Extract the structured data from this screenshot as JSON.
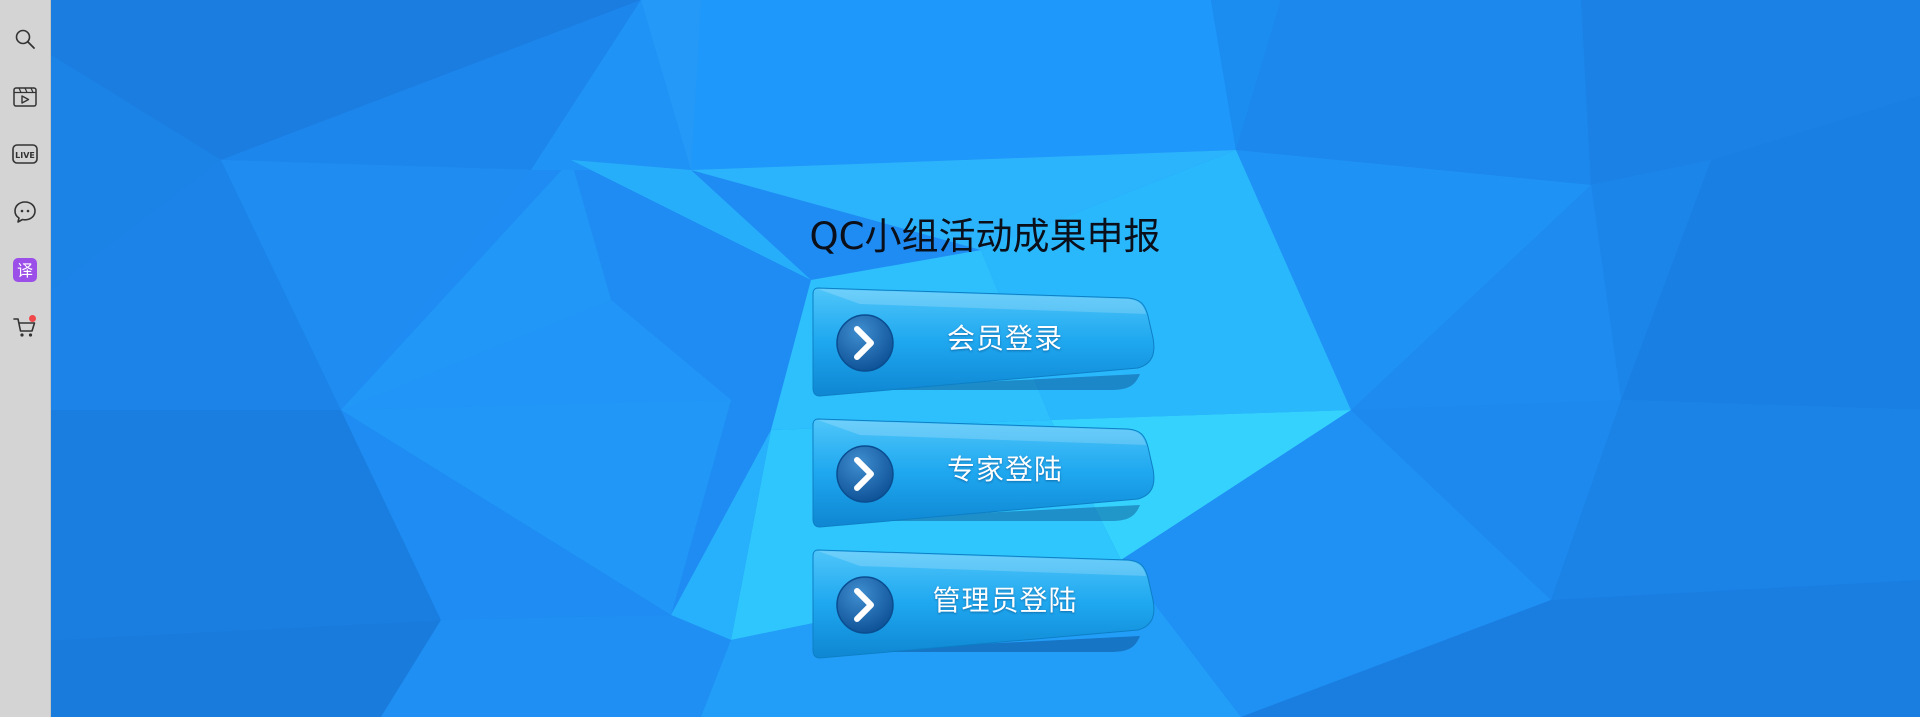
{
  "page": {
    "title": "QC小组活动成果申报"
  },
  "sidebar": {
    "items": [
      {
        "name": "search-icon",
        "has_badge": false
      },
      {
        "name": "video-icon",
        "has_badge": false
      },
      {
        "name": "live-icon",
        "has_badge": false
      },
      {
        "name": "chat-icon",
        "has_badge": false
      },
      {
        "name": "translate-icon",
        "label": "译",
        "has_badge": false
      },
      {
        "name": "cart-icon",
        "has_badge": true
      }
    ],
    "live_label": "LIVE"
  },
  "login": {
    "member_label": "会员登录",
    "expert_label": "专家登陆",
    "admin_label": "管理员登陆"
  },
  "colors": {
    "background_base": "#1e8cf5",
    "button_blue": "#1a9ee8",
    "badge_red": "#f0484a",
    "translate_purple": "#9b4ee8"
  }
}
